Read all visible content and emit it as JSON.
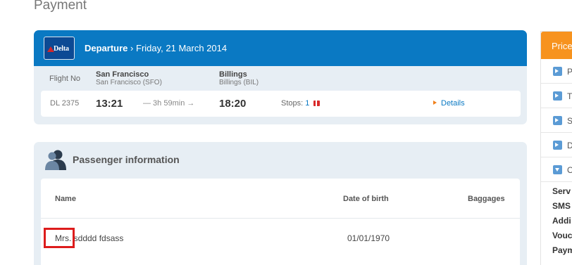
{
  "page": {
    "title": "Payment"
  },
  "flight": {
    "airline": "Delta",
    "direction": "Departure",
    "separator": "›",
    "date": "Friday, 21 March 2014",
    "flight_no_label": "Flight No",
    "origin": {
      "city": "San Francisco",
      "airport": "San Francisco (SFO)"
    },
    "destination": {
      "city": "Billings",
      "airport": "Billings (BIL)"
    },
    "flight_no": "DL 2375",
    "depart_time": "13:21",
    "duration": "— 3h 59min →",
    "arrive_time": "18:20",
    "stops_label": "Stops:",
    "stops_count": "1",
    "details_label": "Details"
  },
  "passenger": {
    "title": "Passenger information",
    "columns": {
      "name": "Name",
      "dob": "Date of birth",
      "baggage": "Baggages"
    },
    "rows": [
      {
        "name": "Mrs. sdddd fdsass",
        "dob": "01/01/1970"
      }
    ]
  },
  "price_panel": {
    "header": "Price",
    "items": [
      {
        "label": "P",
        "expanded": false
      },
      {
        "label": "T",
        "expanded": false
      },
      {
        "label": "S",
        "expanded": false
      },
      {
        "label": "D",
        "expanded": false
      },
      {
        "label": "O",
        "expanded": true
      }
    ],
    "summary": [
      "Serv",
      "SMS",
      "Addi",
      "Vouc",
      "Paym"
    ]
  },
  "colors": {
    "header_blue": "#0a79c3",
    "card_bg": "#e7eef4",
    "price_orange": "#f7931e",
    "highlight_red": "#dd1c1c"
  }
}
